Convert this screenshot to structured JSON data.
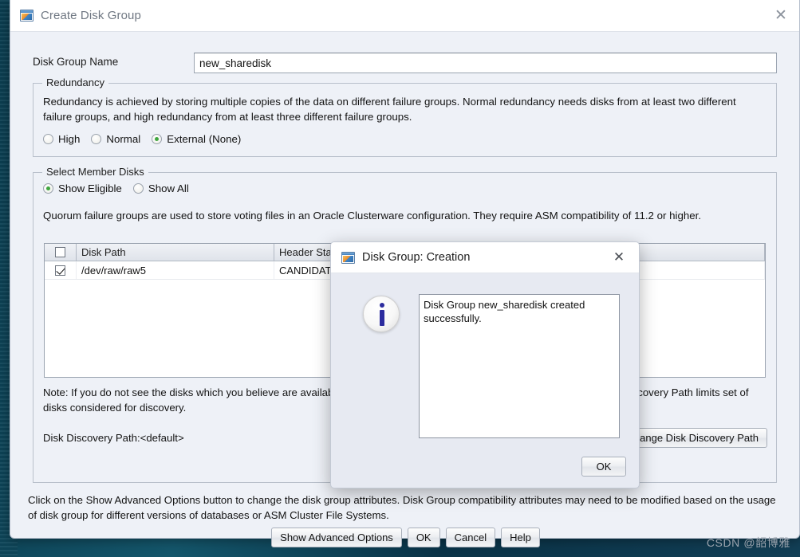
{
  "desktop": {
    "watermark": "CSDN @韶博雅"
  },
  "window": {
    "title": "Create Disk Group",
    "icon": "disk-group-window-icon",
    "close_icon": "close-icon"
  },
  "form": {
    "disk_group_name_label": "Disk Group Name",
    "disk_group_name_value": "new_sharedisk",
    "disk_group_name_placeholder": ""
  },
  "redundancy": {
    "legend": "Redundancy",
    "description": "Redundancy is achieved by storing multiple copies of the data on different failure groups. Normal redundancy needs disks from at least two different failure groups, and high redundancy from at least three different failure groups.",
    "options": [
      {
        "label": "High",
        "checked": false
      },
      {
        "label": "Normal",
        "checked": false
      },
      {
        "label": "External (None)",
        "checked": true
      }
    ]
  },
  "member_disks": {
    "legend": "Select Member Disks",
    "show_options": [
      {
        "label": "Show Eligible",
        "checked": true
      },
      {
        "label": "Show All",
        "checked": false
      }
    ],
    "quorum_note": "Quorum failure groups are used to store voting files in an Oracle Clusterware configuration. They require ASM compatibility of 11.2 or higher.",
    "table": {
      "columns": [
        "",
        "Disk Path",
        "Header Status",
        ""
      ],
      "header_checkbox_checked": false,
      "rows": [
        {
          "checked": true,
          "disk_path": "/dev/raw/raw5",
          "header_status": "CANDIDATE",
          "rest": ""
        }
      ]
    },
    "note": "Note: If you do not see the disks which you believe are available, check the path and the permissions on the disks. The Disk Discovery Path limits set of disks considered for discovery.",
    "discovery_path_label": "Disk Discovery Path:<default>",
    "change_discovery_path_button": "Change Disk Discovery Path"
  },
  "footer": {
    "hint": "Click on the Show Advanced Options button to change the disk group attributes. Disk Group compatibility attributes may need to be modified based on the usage of disk group for different versions of databases or ASM Cluster File Systems.",
    "buttons": [
      "Show Advanced Options",
      "OK",
      "Cancel",
      "Help"
    ]
  },
  "modal": {
    "title": "Disk Group: Creation",
    "icon": "disk-group-window-icon",
    "close_icon": "close-icon",
    "severity_icon": "info-icon",
    "message": "Disk Group new_sharedisk created successfully.",
    "ok_button": "OK"
  },
  "colors": {
    "accent_green": "#3fa63f",
    "info_blue": "#2b2b9e",
    "window_bg": "#eef1f7",
    "desktop_bg": "#0e4a5c"
  }
}
